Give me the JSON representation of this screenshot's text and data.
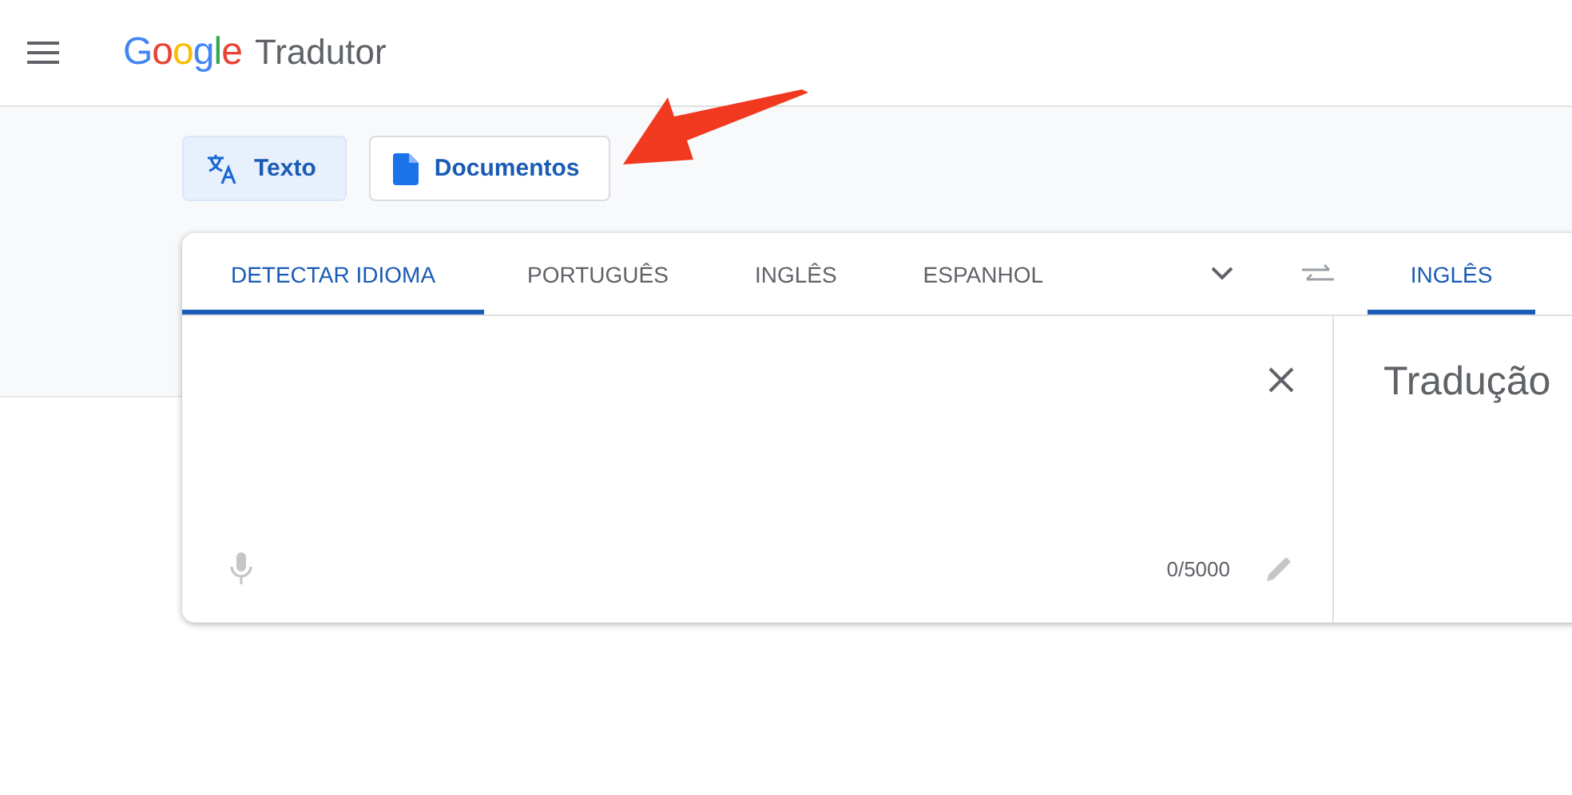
{
  "header": {
    "logo": "Google",
    "product": "Tradutor"
  },
  "modes": [
    {
      "label": "Texto",
      "kind": "text",
      "selected": true
    },
    {
      "label": "Documentos",
      "kind": "document",
      "selected": false
    }
  ],
  "source_languages": [
    {
      "label": "DETECTAR IDIOMA",
      "selected": true
    },
    {
      "label": "PORTUGUÊS",
      "selected": false
    },
    {
      "label": "INGLÊS",
      "selected": false
    },
    {
      "label": "ESPANHOL",
      "selected": false
    }
  ],
  "target_languages": [
    {
      "label": "INGLÊS",
      "selected": true
    }
  ],
  "source": {
    "char_count": "0/5000"
  },
  "target": {
    "placeholder": "Tradução"
  }
}
